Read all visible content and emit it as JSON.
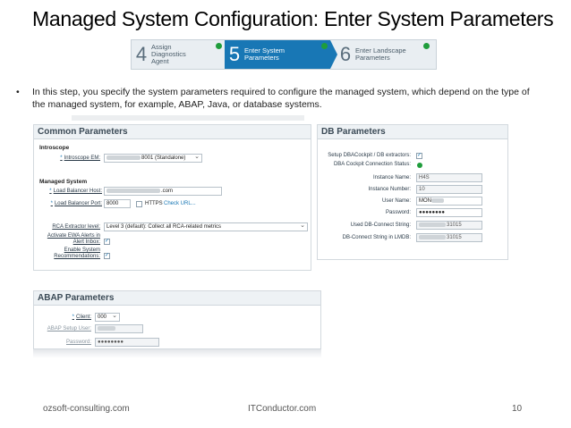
{
  "slide": {
    "title": "Managed System Configuration: Enter System Parameters",
    "bullet_marker": "•",
    "bullet_text": "In this step, you specify the system parameters required to configure the managed system, which depend on the type of the managed system, for example, ABAP, Java, or database systems."
  },
  "steps": [
    {
      "num": "4",
      "label_lines": [
        "Assign",
        "Diagnostics",
        "Agent"
      ]
    },
    {
      "num": "5",
      "label_lines": [
        "Enter System",
        "Parameters"
      ]
    },
    {
      "num": "6",
      "label_lines": [
        "Enter Landscape",
        "Parameters"
      ]
    }
  ],
  "common": {
    "header": "Common Parameters",
    "introscope_section": "Introscope",
    "introscope_em_label": "Introscope EM:",
    "introscope_em_value": "8001 (Standalone)",
    "managed_section": "Managed System",
    "lb_host_label": "Load Balancer Host:",
    "lb_host_value": ".com",
    "lb_port_label": "Load Balancer Port:",
    "lb_port_value": "8000",
    "https_label": "HTTPS",
    "check_url": "Check URL...",
    "rca_label": "RCA Extractor level:",
    "rca_value": "Level 3 (default): Collect all RCA-related metrics",
    "ewa_label_1": "Activate EWA Alerts in",
    "ewa_label_2": "Alert Inbox:",
    "ewa_checked": "✓",
    "recommend_label_1": "Enable System",
    "recommend_label_2": "Recommendations:",
    "recommend_checked": "✓"
  },
  "db": {
    "header": "DB Parameters",
    "setup_label": "Setup DBACockpit / DB extractors:",
    "setup_checked": "✓",
    "status_label": "DBA Cockpit Connection Status:",
    "instance_name_label": "Instance Name:",
    "instance_name_value": "H4S",
    "instance_number_label": "Instance Number:",
    "instance_number_value": "10",
    "user_name_label": "User Name:",
    "user_name_value": "MON",
    "password_label": "Password:",
    "password_value": "●●●●●●●●",
    "used_db_label": "Used DB-Connect String:",
    "used_db_value": "31015",
    "lmdb_label": "DB-Connect String in LMDB:",
    "lmdb_value": "31015"
  },
  "abap": {
    "header": "ABAP Parameters",
    "client_label": "Client:",
    "client_value": "000",
    "setup_user_label": "ABAP Setup User:",
    "password_label": "Password:",
    "password_value": "●●●●●●●●"
  },
  "footer": {
    "left": "ozsoft-consulting.com",
    "center": "ITConductor.com",
    "page": "10"
  },
  "colors": {
    "accent": "#1877b5",
    "status_green": "#1f9d3c"
  }
}
